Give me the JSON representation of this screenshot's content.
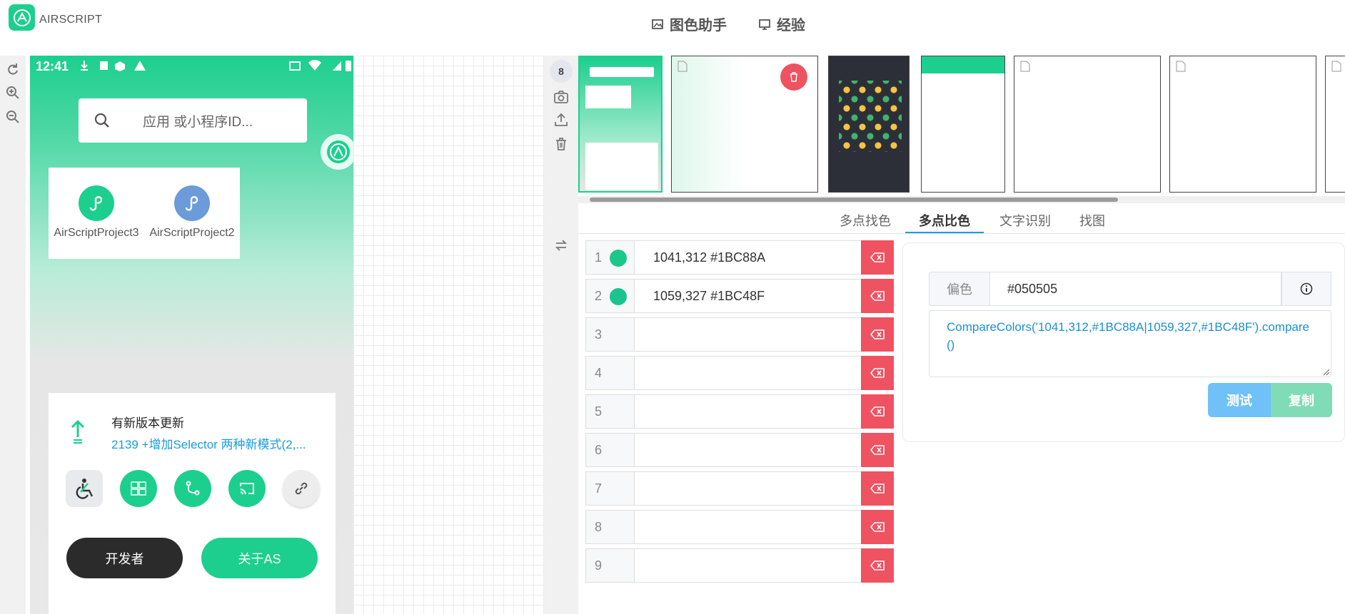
{
  "app": {
    "brand": "AIRSCRIPT"
  },
  "nav": [
    {
      "label": "图色助手",
      "icon": "image-icon"
    },
    {
      "label": "经验",
      "icon": "monitor-icon"
    }
  ],
  "left_tools": [
    "refresh-icon",
    "zoom-in-icon",
    "zoom-out-icon"
  ],
  "phone": {
    "status_time": "12:41",
    "search_placeholder": "应用 或小程序ID...",
    "apps": [
      {
        "label": "AirScriptProject3",
        "color": "#1ccf8e"
      },
      {
        "label": "AirScriptProject2",
        "color": "#6b9bd8"
      }
    ],
    "update": {
      "title": "有新版本更新",
      "desc": "2139  +增加Selector 两种新模式(2,..."
    },
    "buttons": {
      "developer": "开发者",
      "about": "关于AS"
    }
  },
  "thumbs": {
    "count": "8"
  },
  "tabs": [
    {
      "label": "多点找色",
      "active": false
    },
    {
      "label": "多点比色",
      "active": true
    },
    {
      "label": "文字识别",
      "active": false
    },
    {
      "label": "找图",
      "active": false
    }
  ],
  "points": [
    {
      "index": "1",
      "value": "1041,312 #1BC88A",
      "color": "#1BC88A"
    },
    {
      "index": "2",
      "value": "1059,327 #1BC48F",
      "color": "#1BC48F"
    },
    {
      "index": "3",
      "value": "",
      "color": ""
    },
    {
      "index": "4",
      "value": "",
      "color": ""
    },
    {
      "index": "5",
      "value": "",
      "color": ""
    },
    {
      "index": "6",
      "value": "",
      "color": ""
    },
    {
      "index": "7",
      "value": "",
      "color": ""
    },
    {
      "index": "8",
      "value": "",
      "color": ""
    },
    {
      "index": "9",
      "value": "",
      "color": ""
    }
  ],
  "panel": {
    "offset_label": "偏色",
    "offset_value": "#050505",
    "code": "CompareColors('1041,312,#1BC88A|1059,327,#1BC48F').compare()",
    "test_label": "测试",
    "copy_label": "复制"
  },
  "colors": {
    "accent": "#1ccf8e",
    "danger": "#ef5261",
    "link": "#1a9be0"
  }
}
